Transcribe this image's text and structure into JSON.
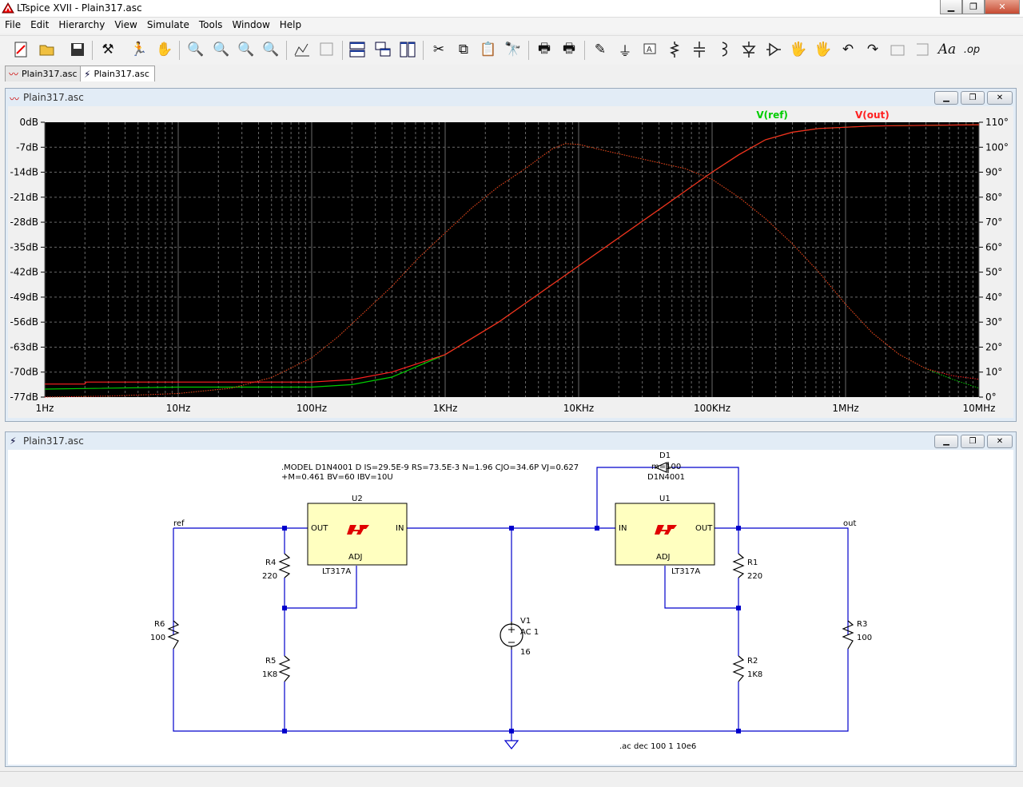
{
  "app": {
    "title": "LTspice XVII - Plain317.asc"
  },
  "menu": [
    "File",
    "Edit",
    "Hierarchy",
    "View",
    "Simulate",
    "Tools",
    "Window",
    "Help"
  ],
  "tabs": [
    {
      "label": "Plain317.asc"
    },
    {
      "label": "Plain317.asc"
    }
  ],
  "toolbar_icons": [
    "new-schematic-icon",
    "open-icon",
    "save-icon",
    "control-panel-icon",
    "run-icon",
    "halt-icon",
    "zoom-in-icon",
    "zoom-pan-icon",
    "zoom-out-icon",
    "zoom-cancel-icon",
    "autorange-icon",
    "waveform-icon",
    "tile-horizontal-icon",
    "cascade-icon",
    "tile-vertical-icon",
    "cut-icon",
    "copy-icon",
    "paste-icon",
    "find-icon",
    "print-icon",
    "print-setup-icon",
    "wire-icon",
    "ground-icon",
    "label-net-icon",
    "resistor-icon",
    "capacitor-icon",
    "inductor-icon",
    "diode-icon",
    "component-icon",
    "move-icon",
    "drag-icon",
    "undo-icon",
    "redo-icon",
    "rotate-icon",
    "mirror-icon",
    "text-icon",
    "spice-directive-icon"
  ],
  "waveform_window": {
    "title": "Plain317.asc"
  },
  "schematic_window": {
    "title": "Plain317.asc"
  },
  "chart_data": {
    "type": "line",
    "x_scale": "log",
    "xlim": [
      1,
      10000000
    ],
    "x_ticks": [
      "1Hz",
      "10Hz",
      "100Hz",
      "1KHz",
      "10KHz",
      "100KHz",
      "1MHz",
      "10MHz"
    ],
    "ylim_left": [
      -77,
      0
    ],
    "y_ticks_left": [
      "0dB",
      "-7dB",
      "-14dB",
      "-21dB",
      "-28dB",
      "-35dB",
      "-42dB",
      "-49dB",
      "-56dB",
      "-63dB",
      "-70dB",
      "-77dB"
    ],
    "ylim_right": [
      0,
      110
    ],
    "y_ticks_right": [
      "110°",
      "100°",
      "90°",
      "80°",
      "70°",
      "60°",
      "50°",
      "40°",
      "30°",
      "20°",
      "10°",
      "0°"
    ],
    "grid": true,
    "background": "#000000",
    "series": [
      {
        "name": "V(ref)",
        "color": "#00cc00",
        "label_x": 5.45,
        "magnitude": [
          [
            0,
            -77
          ],
          [
            0.5,
            -76.7
          ],
          [
            1,
            -76
          ],
          [
            1.4,
            -74.5
          ],
          [
            1.7,
            -71.5
          ],
          [
            2,
            -66
          ],
          [
            2.2,
            -60
          ],
          [
            2.4,
            -53
          ],
          [
            2.6,
            -46
          ],
          [
            2.8,
            -38
          ],
          [
            3,
            -31
          ],
          [
            3.2,
            -24
          ],
          [
            3.4,
            -18
          ],
          [
            3.6,
            -13
          ],
          [
            3.8,
            -7.5
          ],
          [
            3.9,
            -6
          ],
          [
            4,
            -6.2
          ],
          [
            4.2,
            -8
          ],
          [
            4.5,
            -10.5
          ],
          [
            4.8,
            -13
          ],
          [
            5,
            -16
          ],
          [
            5.2,
            -21
          ],
          [
            5.4,
            -27
          ],
          [
            5.6,
            -34
          ],
          [
            5.8,
            -42
          ],
          [
            6,
            -51
          ],
          [
            6.2,
            -59
          ],
          [
            6.4,
            -65
          ],
          [
            6.6,
            -69
          ],
          [
            6.8,
            -72
          ],
          [
            7,
            -74.5
          ]
        ],
        "phase": [
          [
            0,
            3.2
          ],
          [
            1,
            4
          ],
          [
            2,
            4
          ],
          [
            2.3,
            5
          ],
          [
            2.6,
            8
          ],
          [
            3,
            17
          ],
          [
            3.4,
            30
          ],
          [
            3.8,
            45
          ],
          [
            4.2,
            60
          ],
          [
            4.6,
            75
          ],
          [
            5,
            90
          ],
          [
            5.2,
            97
          ],
          [
            5.4,
            103
          ],
          [
            5.6,
            106
          ],
          [
            5.8,
            107.5
          ],
          [
            6.2,
            108.5
          ],
          [
            7,
            109
          ]
        ]
      },
      {
        "name": "V(out)",
        "color": "#ff2020",
        "label_x": 6.2,
        "magnitude": [
          [
            0,
            -77
          ],
          [
            0.5,
            -76.7
          ],
          [
            1,
            -76
          ],
          [
            1.4,
            -74.5
          ],
          [
            1.7,
            -71.5
          ],
          [
            2,
            -66
          ],
          [
            2.2,
            -60
          ],
          [
            2.4,
            -53
          ],
          [
            2.6,
            -46
          ],
          [
            2.8,
            -38
          ],
          [
            3,
            -31
          ],
          [
            3.2,
            -24
          ],
          [
            3.4,
            -18
          ],
          [
            3.6,
            -13
          ],
          [
            3.8,
            -7.5
          ],
          [
            3.9,
            -6
          ],
          [
            4,
            -6.2
          ],
          [
            4.2,
            -8
          ],
          [
            4.5,
            -10.5
          ],
          [
            4.8,
            -13
          ],
          [
            5,
            -16
          ],
          [
            5.2,
            -21
          ],
          [
            5.4,
            -27
          ],
          [
            5.6,
            -34
          ],
          [
            5.8,
            -42
          ],
          [
            6,
            -51
          ],
          [
            6.2,
            -59
          ],
          [
            6.4,
            -65
          ],
          [
            6.6,
            -69
          ],
          [
            6.8,
            -71
          ],
          [
            7,
            -72
          ]
        ],
        "phase": [
          [
            0,
            5.2
          ],
          [
            0.3,
            5.2
          ],
          [
            0.31,
            6
          ],
          [
            1,
            6
          ],
          [
            2,
            6
          ],
          [
            2.3,
            7
          ],
          [
            2.6,
            10
          ],
          [
            3,
            17
          ],
          [
            3.4,
            30
          ],
          [
            3.8,
            45
          ],
          [
            4.2,
            60
          ],
          [
            4.6,
            75
          ],
          [
            5,
            90
          ],
          [
            5.2,
            97
          ],
          [
            5.4,
            103
          ],
          [
            5.6,
            106
          ],
          [
            5.8,
            107.5
          ],
          [
            6.2,
            108.5
          ],
          [
            7,
            109
          ]
        ]
      }
    ]
  },
  "schematic": {
    "model_directive_line1": ".MODEL D1N4001 D IS=29.5E-9 RS=73.5E-3 N=1.96 CJO=34.6P VJ=0.627",
    "model_directive_line2": "+M=0.461 BV=60 IBV=10U",
    "ac_directive": ".ac dec 100 1 10e6",
    "nets": {
      "ref": "ref",
      "out": "out"
    },
    "regulators": [
      {
        "ref": "U2",
        "part": "LT317A",
        "pin_out": "OUT",
        "pin_in": "IN",
        "pin_adj": "ADJ"
      },
      {
        "ref": "U1",
        "part": "LT317A",
        "pin_out": "OUT",
        "pin_in": "IN",
        "pin_adj": "ADJ"
      }
    ],
    "resistors": [
      {
        "ref": "R4",
        "value": "220"
      },
      {
        "ref": "R5",
        "value": "1K8"
      },
      {
        "ref": "R6",
        "value": "100"
      },
      {
        "ref": "R1",
        "value": "220"
      },
      {
        "ref": "R2",
        "value": "1K8"
      },
      {
        "ref": "R3",
        "value": "100"
      }
    ],
    "source": {
      "ref": "V1",
      "ac": "AC 1",
      "dc": "16"
    },
    "diode": {
      "ref": "D1",
      "extra": "m=100",
      "model": "D1N4001"
    },
    "wire_color": "#0000cc",
    "component_color": "#ffffc0"
  }
}
